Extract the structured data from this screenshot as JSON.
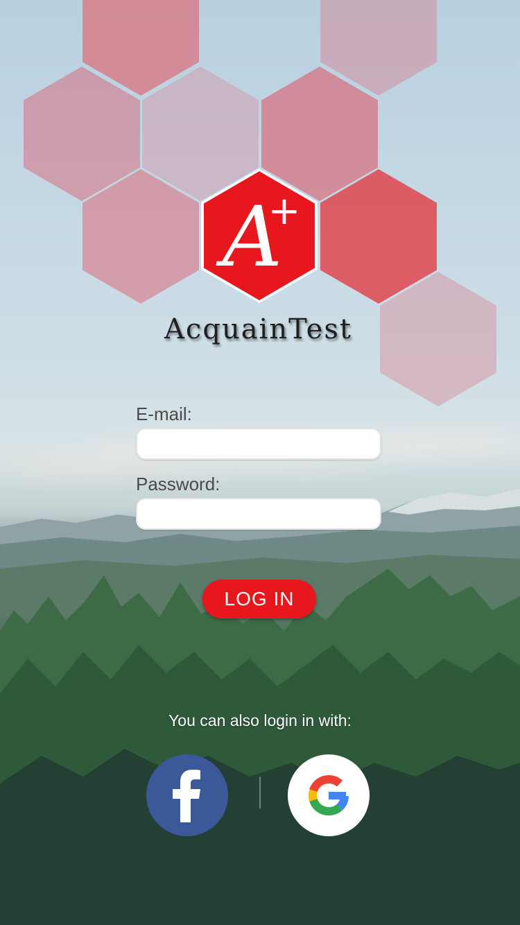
{
  "app": {
    "name": "AcquainTest",
    "logo_letter": "A",
    "logo_superscript": "+"
  },
  "form": {
    "email_label": "E-mail:",
    "email_value": "",
    "password_label": "Password:",
    "password_value": "",
    "login_label": "LOG IN"
  },
  "social": {
    "prompt": "You can also login in with:",
    "facebook_icon": "facebook-icon",
    "google_icon": "google-icon"
  },
  "colors": {
    "accent": "#e8171d",
    "facebook": "#3b5998",
    "google_blue": "#4285f4",
    "google_red": "#ea4335",
    "google_yellow": "#fbbc05",
    "google_green": "#34a853"
  }
}
